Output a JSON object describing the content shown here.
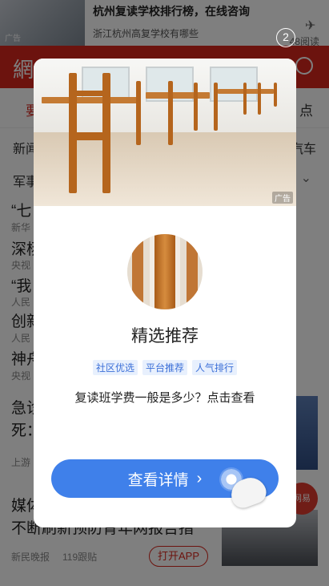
{
  "top_ad": {
    "ad_label": "广告",
    "title": "杭州复读学校排行榜，在线咨询",
    "subtitle": "浙江杭州高复学校有哪些",
    "reads": "48阅读"
  },
  "header": {
    "logo": "網"
  },
  "channels": {
    "left": "要",
    "right": "点"
  },
  "subnav": {
    "left": "新闻",
    "right": "汽车",
    "row2_left": "军事"
  },
  "feed": {
    "line1": "“七",
    "src1": "新华",
    "line2": "深杨",
    "src2": "央视",
    "line3": "“我",
    "src3": "人民",
    "line4": "创新",
    "src4": "人民",
    "line5": "神舟",
    "src5": "央视",
    "line6": "急诊",
    "line7": "死：",
    "src6": "上游",
    "line8": "媒体",
    "line9": "不断刷新预防青年网报告指",
    "src7": "新民晚报",
    "comments": "119跟贴",
    "open_app": "打开APP",
    "float_label": "网易"
  },
  "modal": {
    "skip_count": "2",
    "hero_ad_label": "广告",
    "title": "精选推荐",
    "tags": [
      "社区优选",
      "平台推荐",
      "人气排行"
    ],
    "description": "复读班学费一般是多少？点击查看",
    "cta_label": "查看详情"
  }
}
